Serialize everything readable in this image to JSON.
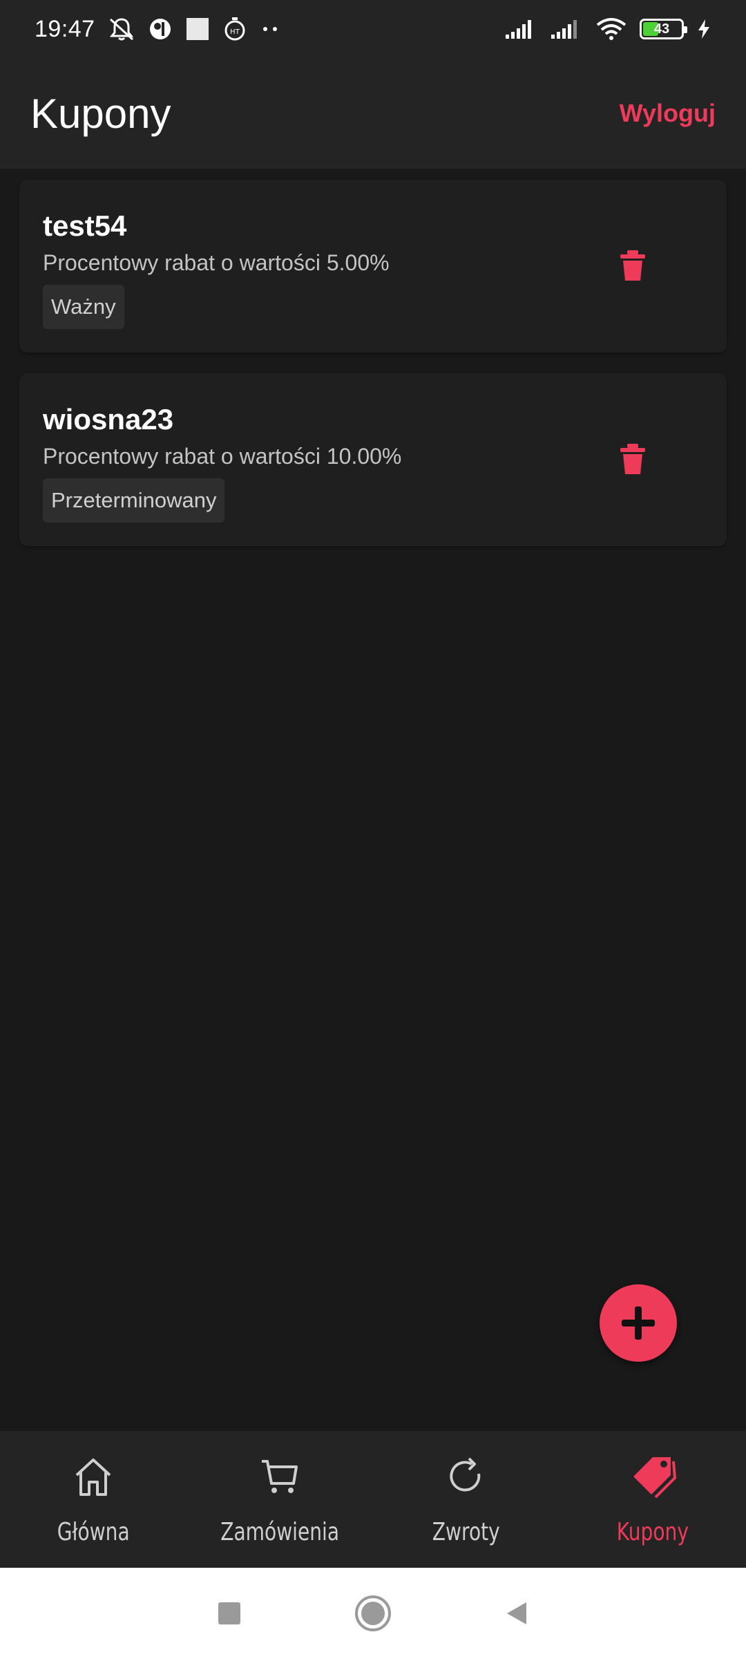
{
  "status_bar": {
    "time": "19:47",
    "battery": "43",
    "icons": [
      "mute-icon",
      "app-icon",
      "square-icon",
      "stopwatch-icon",
      "more-dots-icon",
      "signal-icon",
      "signal-icon",
      "wifi-icon",
      "battery-icon",
      "charging-icon"
    ]
  },
  "app_bar": {
    "title": "Kupony",
    "logout": "Wyloguj"
  },
  "coupons": [
    {
      "code": "test54",
      "description": "Procentowy rabat o wartości 5.00%",
      "status": "Ważny"
    },
    {
      "code": "wiosna23",
      "description": "Procentowy rabat o wartości 10.00%",
      "status": "Przeterminowany"
    }
  ],
  "fab": {
    "icon": "plus-icon"
  },
  "bottom_nav": {
    "items": [
      {
        "label": "Główna",
        "icon": "home-icon",
        "active": false
      },
      {
        "label": "Zamówienia",
        "icon": "cart-icon",
        "active": false
      },
      {
        "label": "Zwroty",
        "icon": "refresh-icon",
        "active": false
      },
      {
        "label": "Kupony",
        "icon": "tags-icon",
        "active": true
      }
    ]
  },
  "colors": {
    "accent": "#ee3b5a",
    "background": "#191919",
    "surface": "#242424",
    "card": "#1f1f1f"
  }
}
